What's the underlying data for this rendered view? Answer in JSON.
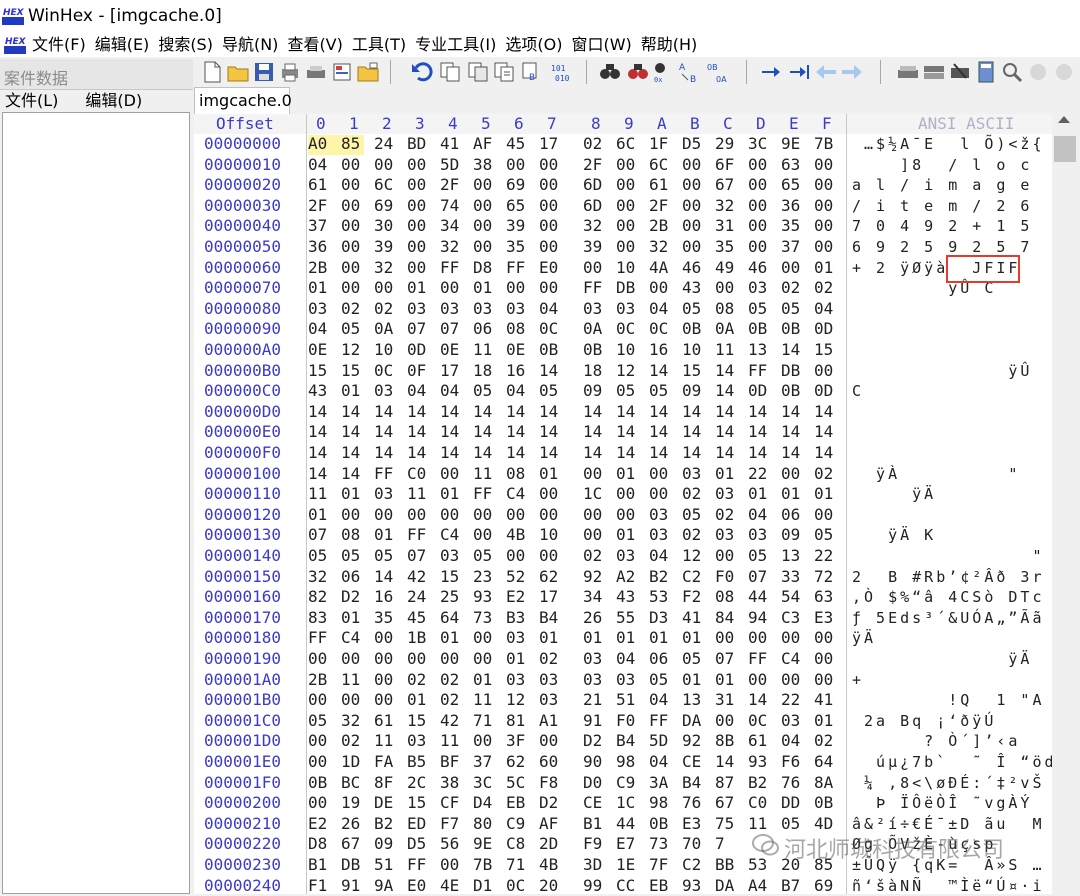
{
  "window": {
    "title": "WinHex - [imgcache.0]",
    "logo_top": "HEX",
    "logo_bottom": "WinHex"
  },
  "menu": [
    "文件(F)",
    "编辑(E)",
    "搜索(S)",
    "导航(N)",
    "查看(V)",
    "工具(T)",
    "专业工具(I)",
    "选项(O)",
    "窗口(W)",
    "帮助(H)"
  ],
  "case_panel": {
    "title": "案件数据",
    "menu": [
      "文件(L)",
      "编辑(D)"
    ]
  },
  "tab": {
    "label": "imgcache.0"
  },
  "hex_view": {
    "offset_header": "Offset",
    "columns": [
      "0",
      "1",
      "2",
      "3",
      "4",
      "5",
      "6",
      "7",
      "8",
      "9",
      "A",
      "B",
      "C",
      "D",
      "E",
      "F"
    ],
    "ascii_header": "ANSI ASCII",
    "rows": [
      {
        "offset": "00000000",
        "bytes": [
          "A0",
          "85",
          "24",
          "BD",
          "41",
          "AF",
          "45",
          "17",
          "02",
          "6C",
          "1F",
          "D5",
          "29",
          "3C",
          "9E",
          "7B"
        ],
        "ascii": " …$½A¯E  l Õ)<ž{"
      },
      {
        "offset": "00000010",
        "bytes": [
          "04",
          "00",
          "00",
          "00",
          "5D",
          "38",
          "00",
          "00",
          "2F",
          "00",
          "6C",
          "00",
          "6F",
          "00",
          "63",
          "00"
        ],
        "ascii": "    ]8  / l o c "
      },
      {
        "offset": "00000020",
        "bytes": [
          "61",
          "00",
          "6C",
          "00",
          "2F",
          "00",
          "69",
          "00",
          "6D",
          "00",
          "61",
          "00",
          "67",
          "00",
          "65",
          "00"
        ],
        "ascii": "a l / i m a g e "
      },
      {
        "offset": "00000030",
        "bytes": [
          "2F",
          "00",
          "69",
          "00",
          "74",
          "00",
          "65",
          "00",
          "6D",
          "00",
          "2F",
          "00",
          "32",
          "00",
          "36",
          "00"
        ],
        "ascii": "/ i t e m / 2 6 "
      },
      {
        "offset": "00000040",
        "bytes": [
          "37",
          "00",
          "30",
          "00",
          "34",
          "00",
          "39",
          "00",
          "32",
          "00",
          "2B",
          "00",
          "31",
          "00",
          "35",
          "00"
        ],
        "ascii": "7 0 4 9 2 + 1 5 "
      },
      {
        "offset": "00000050",
        "bytes": [
          "36",
          "00",
          "39",
          "00",
          "32",
          "00",
          "35",
          "00",
          "39",
          "00",
          "32",
          "00",
          "35",
          "00",
          "37",
          "00"
        ],
        "ascii": "6 9 2 5 9 2 5 7 "
      },
      {
        "offset": "00000060",
        "bytes": [
          "2B",
          "00",
          "32",
          "00",
          "FF",
          "D8",
          "FF",
          "E0",
          "00",
          "10",
          "4A",
          "46",
          "49",
          "46",
          "00",
          "01"
        ],
        "ascii": "+ 2 ÿØÿà  JFIF  "
      },
      {
        "offset": "00000070",
        "bytes": [
          "01",
          "00",
          "00",
          "01",
          "00",
          "01",
          "00",
          "00",
          "FF",
          "DB",
          "00",
          "43",
          "00",
          "03",
          "02",
          "02"
        ],
        "ascii": "        ÿÛ C    "
      },
      {
        "offset": "00000080",
        "bytes": [
          "03",
          "02",
          "02",
          "03",
          "03",
          "03",
          "03",
          "04",
          "03",
          "03",
          "04",
          "05",
          "08",
          "05",
          "05",
          "04"
        ],
        "ascii": "                "
      },
      {
        "offset": "00000090",
        "bytes": [
          "04",
          "05",
          "0A",
          "07",
          "07",
          "06",
          "08",
          "0C",
          "0A",
          "0C",
          "0C",
          "0B",
          "0A",
          "0B",
          "0B",
          "0D"
        ],
        "ascii": "                "
      },
      {
        "offset": "000000A0",
        "bytes": [
          "0E",
          "12",
          "10",
          "0D",
          "0E",
          "11",
          "0E",
          "0B",
          "0B",
          "10",
          "16",
          "10",
          "11",
          "13",
          "14",
          "15"
        ],
        "ascii": "                "
      },
      {
        "offset": "000000B0",
        "bytes": [
          "15",
          "15",
          "0C",
          "0F",
          "17",
          "18",
          "16",
          "14",
          "18",
          "12",
          "14",
          "15",
          "14",
          "FF",
          "DB",
          "00"
        ],
        "ascii": "             ÿÛ "
      },
      {
        "offset": "000000C0",
        "bytes": [
          "43",
          "01",
          "03",
          "04",
          "04",
          "05",
          "04",
          "05",
          "09",
          "05",
          "05",
          "09",
          "14",
          "0D",
          "0B",
          "0D"
        ],
        "ascii": "C               "
      },
      {
        "offset": "000000D0",
        "bytes": [
          "14",
          "14",
          "14",
          "14",
          "14",
          "14",
          "14",
          "14",
          "14",
          "14",
          "14",
          "14",
          "14",
          "14",
          "14",
          "14"
        ],
        "ascii": "                "
      },
      {
        "offset": "000000E0",
        "bytes": [
          "14",
          "14",
          "14",
          "14",
          "14",
          "14",
          "14",
          "14",
          "14",
          "14",
          "14",
          "14",
          "14",
          "14",
          "14",
          "14"
        ],
        "ascii": "                "
      },
      {
        "offset": "000000F0",
        "bytes": [
          "14",
          "14",
          "14",
          "14",
          "14",
          "14",
          "14",
          "14",
          "14",
          "14",
          "14",
          "14",
          "14",
          "14",
          "14",
          "14"
        ],
        "ascii": "                "
      },
      {
        "offset": "00000100",
        "bytes": [
          "14",
          "14",
          "FF",
          "C0",
          "00",
          "11",
          "08",
          "01",
          "00",
          "01",
          "00",
          "03",
          "01",
          "22",
          "00",
          "02"
        ],
        "ascii": "  ÿÀ         \"  "
      },
      {
        "offset": "00000110",
        "bytes": [
          "11",
          "01",
          "03",
          "11",
          "01",
          "FF",
          "C4",
          "00",
          "1C",
          "00",
          "00",
          "02",
          "03",
          "01",
          "01",
          "01"
        ],
        "ascii": "     ÿÄ         "
      },
      {
        "offset": "00000120",
        "bytes": [
          "01",
          "00",
          "00",
          "00",
          "00",
          "00",
          "00",
          "00",
          "00",
          "00",
          "03",
          "05",
          "02",
          "04",
          "06",
          "00"
        ],
        "ascii": "                "
      },
      {
        "offset": "00000130",
        "bytes": [
          "07",
          "08",
          "01",
          "FF",
          "C4",
          "00",
          "4B",
          "10",
          "00",
          "01",
          "03",
          "02",
          "03",
          "03",
          "09",
          "05"
        ],
        "ascii": "   ÿÄ K         "
      },
      {
        "offset": "00000140",
        "bytes": [
          "05",
          "05",
          "05",
          "07",
          "03",
          "05",
          "00",
          "00",
          "02",
          "03",
          "04",
          "12",
          "00",
          "05",
          "13",
          "22"
        ],
        "ascii": "               \""
      },
      {
        "offset": "00000150",
        "bytes": [
          "32",
          "06",
          "14",
          "42",
          "15",
          "23",
          "52",
          "62",
          "92",
          "A2",
          "B2",
          "C2",
          "F0",
          "07",
          "33",
          "72"
        ],
        "ascii": "2  B #Rb’¢²Âð 3r"
      },
      {
        "offset": "00000160",
        "bytes": [
          "82",
          "D2",
          "16",
          "24",
          "25",
          "93",
          "E2",
          "17",
          "34",
          "43",
          "53",
          "F2",
          "08",
          "44",
          "54",
          "63"
        ],
        "ascii": ",Ò $%“â 4CSò DTc"
      },
      {
        "offset": "00000170",
        "bytes": [
          "83",
          "01",
          "35",
          "45",
          "64",
          "73",
          "B3",
          "B4",
          "26",
          "55",
          "D3",
          "41",
          "84",
          "94",
          "C3",
          "E3"
        ],
        "ascii": "ƒ 5Eds³´&UÓA„”Ãã"
      },
      {
        "offset": "00000180",
        "bytes": [
          "FF",
          "C4",
          "00",
          "1B",
          "01",
          "00",
          "03",
          "01",
          "01",
          "01",
          "01",
          "01",
          "00",
          "00",
          "00",
          "00"
        ],
        "ascii": "ÿÄ              "
      },
      {
        "offset": "00000190",
        "bytes": [
          "00",
          "00",
          "00",
          "00",
          "00",
          "00",
          "01",
          "02",
          "03",
          "04",
          "06",
          "05",
          "07",
          "FF",
          "C4",
          "00"
        ],
        "ascii": "             ÿÄ "
      },
      {
        "offset": "000001A0",
        "bytes": [
          "2B",
          "11",
          "00",
          "02",
          "02",
          "01",
          "03",
          "03",
          "03",
          "03",
          "05",
          "01",
          "01",
          "00",
          "00",
          "00"
        ],
        "ascii": "+               "
      },
      {
        "offset": "000001B0",
        "bytes": [
          "00",
          "00",
          "00",
          "01",
          "02",
          "11",
          "12",
          "03",
          "21",
          "51",
          "04",
          "13",
          "31",
          "14",
          "22",
          "41"
        ],
        "ascii": "        !Q  1 \"A"
      },
      {
        "offset": "000001C0",
        "bytes": [
          "05",
          "32",
          "61",
          "15",
          "42",
          "71",
          "81",
          "A1",
          "91",
          "F0",
          "FF",
          "DA",
          "00",
          "0C",
          "03",
          "01"
        ],
        "ascii": " 2a Bq ¡‘ðÿÚ    "
      },
      {
        "offset": "000001D0",
        "bytes": [
          "00",
          "02",
          "11",
          "03",
          "11",
          "00",
          "3F",
          "00",
          "D2",
          "B4",
          "5D",
          "92",
          "8B",
          "61",
          "04",
          "02"
        ],
        "ascii": "      ? Ò´]’‹a  "
      },
      {
        "offset": "000001E0",
        "bytes": [
          "00",
          "1D",
          "FA",
          "B5",
          "BF",
          "37",
          "62",
          "60",
          "90",
          "98",
          "04",
          "CE",
          "14",
          "93",
          "F6",
          "64"
        ],
        "ascii": "  úµ¿7b`  ˜ Î “öd"
      },
      {
        "offset": "000001F0",
        "bytes": [
          "0B",
          "BC",
          "8F",
          "2C",
          "38",
          "3C",
          "5C",
          "F8",
          "D0",
          "C9",
          "3A",
          "B4",
          "87",
          "B2",
          "76",
          "8A"
        ],
        "ascii": " ¼ ,8<\\øÐÉ:´‡²vŠ"
      },
      {
        "offset": "00000200",
        "bytes": [
          "00",
          "19",
          "DE",
          "15",
          "CF",
          "D4",
          "EB",
          "D2",
          "CE",
          "1C",
          "98",
          "76",
          "67",
          "C0",
          "DD",
          "0B"
        ],
        "ascii": "  Þ ÏÔëÒÎ ˜vgÀÝ "
      },
      {
        "offset": "00000210",
        "bytes": [
          "E2",
          "26",
          "B2",
          "ED",
          "F7",
          "80",
          "C9",
          "AF",
          "B1",
          "44",
          "0B",
          "E3",
          "75",
          "11",
          "05",
          "4D"
        ],
        "ascii": "â&²í÷€É¯±D ãu  M"
      },
      {
        "offset": "00000220",
        "bytes": [
          "D8",
          "67",
          "09",
          "D5",
          "56",
          "9E",
          "C8",
          "2D",
          "F9",
          "E7",
          "73",
          "70",
          "7",
          " ",
          " ",
          " "
        ],
        "ascii": "Øg ÕVžÈ-ùçsp    "
      },
      {
        "offset": "00000230",
        "bytes": [
          "B1",
          "DB",
          "51",
          "FF",
          "00",
          "7B",
          "71",
          "4B",
          "3D",
          "1E",
          "7F",
          "C2",
          "BB",
          "53",
          "20",
          "85"
        ],
        "ascii": "±ÛQÿ {qK=  Â»S …"
      },
      {
        "offset": "00000240",
        "bytes": [
          "F1",
          "91",
          "9A",
          "E0",
          "4E",
          "D1",
          "0C",
          "20",
          "99",
          "CC",
          "EB",
          "93",
          "DA",
          "A4",
          "B7",
          "69"
        ],
        "ascii": "ñ‘šàNÑ  ™Ìë“Ú¤·i"
      }
    ]
  },
  "watermark": "河北师城科技有限公司"
}
